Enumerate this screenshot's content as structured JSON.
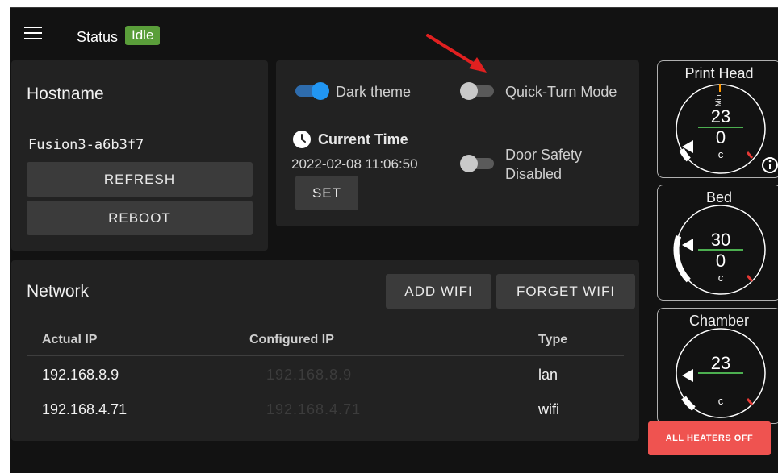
{
  "topbar": {
    "status_label": "Status",
    "status_value": "Idle"
  },
  "hostname_card": {
    "title": "Hostname",
    "hostname": "Fusion3-a6b3f7",
    "refresh_label": "REFRESH",
    "reboot_label": "REBOOT"
  },
  "settings_card": {
    "dark_theme_label": "Dark theme",
    "dark_theme_on": true,
    "quick_turn_label": "Quick-Turn Mode",
    "quick_turn_on": false,
    "current_time_label": "Current Time",
    "current_time_value": "2022-02-08 11:06:50",
    "set_label": "SET",
    "door_safety_label_1": "Door Safety",
    "door_safety_label_2": "Disabled",
    "door_safety_on": false
  },
  "network_card": {
    "title": "Network",
    "add_wifi_label": "ADD WIFI",
    "forget_wifi_label": "FORGET WIFI",
    "columns": [
      "Actual IP",
      "Configured IP",
      "Type"
    ],
    "rows": [
      {
        "actual_ip": "192.168.8.9",
        "configured_ip": "192.168.8.9",
        "type": "lan"
      },
      {
        "actual_ip": "192.168.4.71",
        "configured_ip": "192.168.4.71",
        "type": "wifi"
      }
    ]
  },
  "gauges": {
    "print_head": {
      "title": "Print Head",
      "target": "23",
      "current": "0",
      "unit": "c",
      "min_label": "Min"
    },
    "bed": {
      "title": "Bed",
      "target": "30",
      "current": "0",
      "unit": "c"
    },
    "chamber": {
      "title": "Chamber",
      "target": "23",
      "unit": "c"
    }
  },
  "heaters_off_label": "ALL HEATERS OFF",
  "colors": {
    "accent_blue": "#2196f3",
    "status_green": "#5a9e3a",
    "danger_red": "#ef5350",
    "target_line_green": "#4caf50",
    "annotation_arrow_red": "#e02020"
  }
}
